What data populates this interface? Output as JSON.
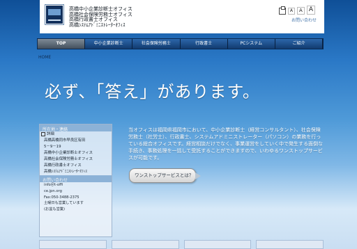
{
  "header": {
    "office_lines": [
      "高橋中小企業診断士オフィス",
      "高橋社会保険労務士オフィス",
      "高橋行政書士オフィス",
      "高橋ｼｽﾃﾑｱﾄﾞﾐﾆｽﾄﾚｰﾀｰｵﾌｨｽ"
    ],
    "font_controls": [
      "A",
      "A",
      "A"
    ],
    "contact_label": "お問い合わせ"
  },
  "nav": {
    "items": [
      "TOP",
      "中小企業診断士",
      "社会保険労務士",
      "行政書士",
      "PCシステム",
      "ご紹介"
    ]
  },
  "breadcrumb": "HOME",
  "hero": "必ず、「答え」があります。",
  "sidebar": {
    "title": "所在地・連絡",
    "items": [
      "詳細",
      "高橋高橋同市早良区有田",
      "5－9－19",
      "高橋中小企業診断士オフィス",
      "高橋社会保険労務士オフィス",
      "高橋行政書士オフィス",
      "高橋ｼｽﾃﾑｱﾄﾞﾐﾆｽﾄﾚｰﾀｰｵﾌｨｽ"
    ],
    "contact_title": "お問い合わせ",
    "contact_items": [
      "info＠t-offi",
      "ce.jpn.org",
      "Fax:050-3488-2375",
      "土曜日も営業しています",
      "(お盆も営業)"
    ]
  },
  "main": {
    "description": "当オフィスは福岡県福岡市において、中小企業診断士（経営コンサルタント）、社会保険労務士（社労士）、行政書士、システムアドミニストレーター（パソコン）の業務を行っている総合オフィスです。経営相談だけでなく、事業運営をしていく中で発生する面倒な手続き、事務処理を一括して受託することができますので、いわゆるワンストップサービスが可能です。",
    "button_label": "ワンストップサービスとは？"
  },
  "colors": {
    "accent": "#2f78c1",
    "nav": "#153d70",
    "sidebar_title": "#8cb2d7"
  },
  "icons": {
    "print": "print-icon",
    "logo": "logo-icon"
  }
}
